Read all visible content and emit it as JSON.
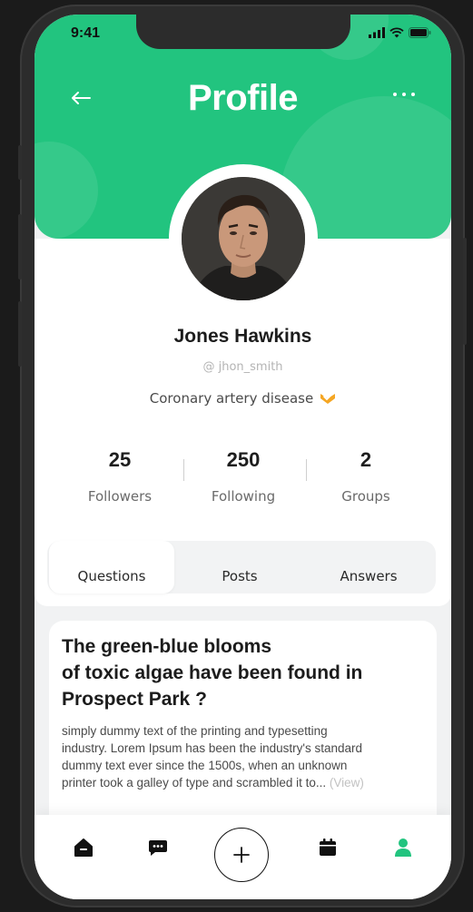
{
  "status_bar": {
    "time": "9:41"
  },
  "header": {
    "title": "Profile"
  },
  "profile": {
    "name": "Jones Hawkins",
    "handle": "@ jhon_smith",
    "condition": "Coronary artery disease"
  },
  "stats": [
    {
      "value": "25",
      "label": "Followers"
    },
    {
      "value": "250",
      "label": "Following"
    },
    {
      "value": "2",
      "label": "Groups"
    }
  ],
  "tabs": [
    {
      "label": "Questions",
      "active": true
    },
    {
      "label": "Posts",
      "active": false
    },
    {
      "label": "Answers",
      "active": false
    }
  ],
  "post": {
    "title_lines": [
      "The green-blue blooms",
      "of toxic algae have been found in",
      "Prospect Park ?"
    ],
    "body_lines": [
      "simply dummy text of the printing and typesetting",
      "industry. Lorem Ipsum has been the industry's standard",
      "dummy text ever since the 1500s, when an unknown",
      "printer took a galley of type and scrambled it to..."
    ],
    "view_label": "(View)"
  },
  "nav": {
    "items": [
      "home-icon",
      "chat-icon",
      "add-icon",
      "calendar-icon",
      "profile-icon"
    ],
    "active": "profile-icon"
  },
  "colors": {
    "accent": "#22c47f",
    "verified_badge": "#f5a623",
    "background": "#f1f2f3"
  }
}
